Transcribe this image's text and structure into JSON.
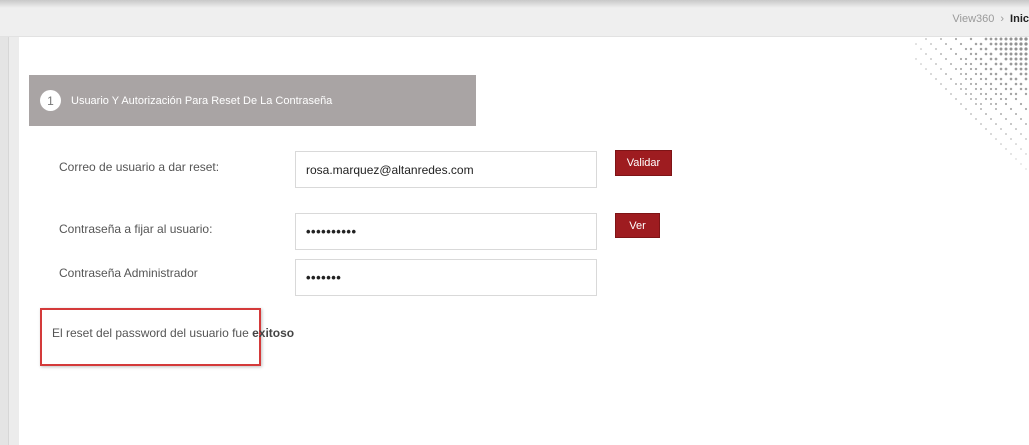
{
  "breadcrumb": {
    "items": [
      "View360",
      "Inic"
    ],
    "separator": "›"
  },
  "step": {
    "number": "1",
    "title": "Usuario Y Autorización Para Reset De La Contraseña"
  },
  "form": {
    "email_label": "Correo de usuario a dar reset:",
    "email_value": "rosa.marquez@altanredes.com",
    "validate_button": "Validar",
    "new_password_label": "Contraseña a fijar al usuario:",
    "new_password_value": "••••••••••",
    "show_button": "Ver",
    "admin_password_label": "Contraseña Administrador",
    "admin_password_value": "•••••••"
  },
  "result": {
    "prefix": "El reset del password del usuario fue",
    "status": "exitoso"
  },
  "colors": {
    "accent": "#9e1c20",
    "step_header_bg": "#a9a4a4",
    "result_border": "#d43a3a"
  },
  "icons": {
    "breadcrumb_separator": "chevron-right-icon",
    "background_pattern": "dot-pattern-decoration"
  }
}
